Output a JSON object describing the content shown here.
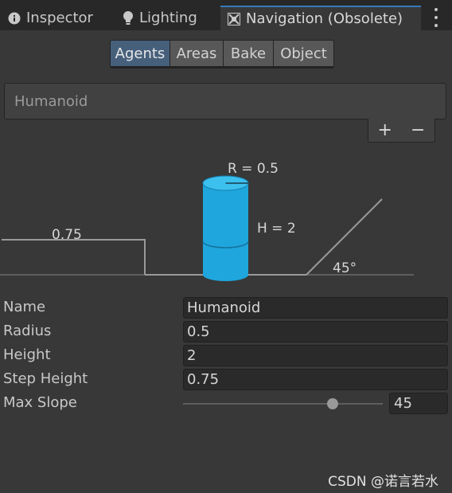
{
  "tabs": [
    {
      "label": "Inspector",
      "icon": "info-icon"
    },
    {
      "label": "Lighting",
      "icon": "lightbulb-icon"
    },
    {
      "label": "Navigation (Obsolete)",
      "icon": "navmesh-icon",
      "active": true
    }
  ],
  "toolbar": {
    "buttons": [
      "Agents",
      "Areas",
      "Bake",
      "Object"
    ],
    "selected": "Agents"
  },
  "agent_list": {
    "items": [
      "Humanoid"
    ],
    "add_label": "+",
    "remove_label": "−"
  },
  "diagram": {
    "radius_label": "R = 0.5",
    "height_label": "H = 2",
    "step_label": "0.75",
    "slope_label": "45°",
    "agent_color": "#1fa6dc"
  },
  "properties": {
    "name": {
      "label": "Name",
      "value": "Humanoid"
    },
    "radius": {
      "label": "Radius",
      "value": "0.5"
    },
    "height": {
      "label": "Height",
      "value": "2"
    },
    "step_height": {
      "label": "Step Height",
      "value": "0.75"
    },
    "max_slope": {
      "label": "Max Slope",
      "value": "45",
      "min": 0,
      "max": 60
    }
  },
  "watermark": "CSDN @诺言若水",
  "colors": {
    "background": "#383838",
    "tabbar": "#282828",
    "active_tab_accent": "#3a79bb",
    "selected_button": "#46607c"
  }
}
